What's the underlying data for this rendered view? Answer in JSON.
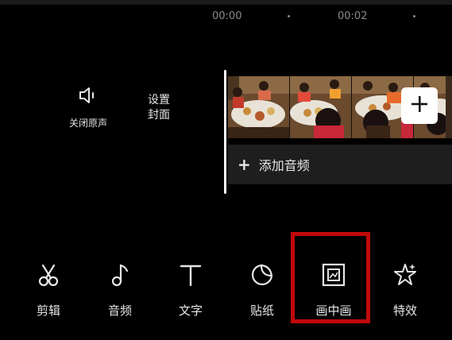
{
  "timeline": {
    "times": [
      "00:00",
      "00:02"
    ]
  },
  "side_controls": {
    "mute_label": "关闭原声",
    "cover_line1": "设置",
    "cover_line2": "封面"
  },
  "track": {
    "add_clip_symbol": "+",
    "add_audio_symbol": "+",
    "add_audio_label": "添加音频"
  },
  "toolbar": {
    "items": [
      {
        "label": "剪辑",
        "icon": "scissors-icon"
      },
      {
        "label": "音频",
        "icon": "music-note-icon"
      },
      {
        "label": "文字",
        "icon": "text-icon"
      },
      {
        "label": "贴纸",
        "icon": "sticker-icon"
      },
      {
        "label": "画中画",
        "icon": "picture-in-picture-icon"
      },
      {
        "label": "特效",
        "icon": "star-effects-icon"
      }
    ]
  },
  "colors": {
    "background": "#000000",
    "highlight": "#c0090a",
    "text": "#e6e6e6",
    "muted_text": "#8a8a8a",
    "track_bg": "#1e1e1e"
  }
}
